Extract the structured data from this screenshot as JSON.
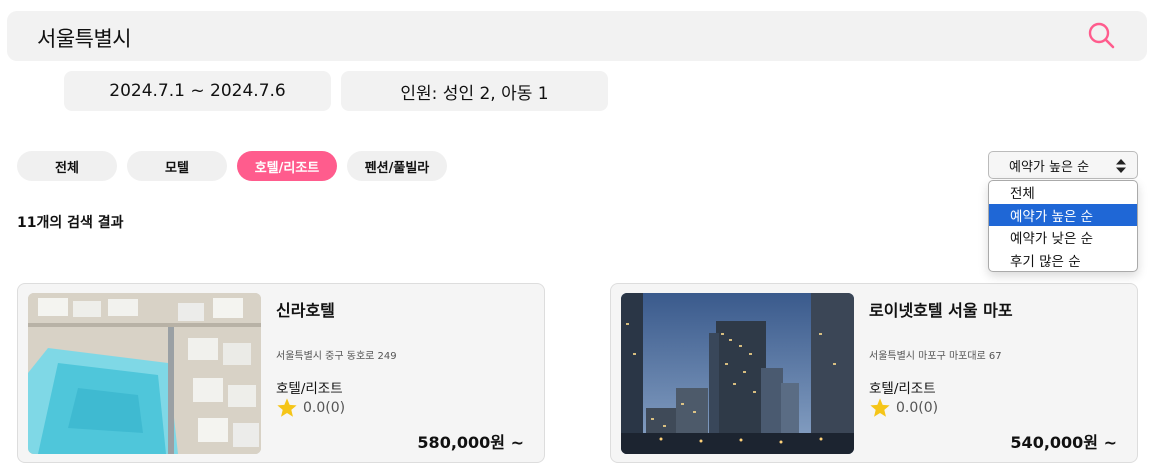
{
  "search": {
    "query": "서울특별시",
    "icon": "search-icon",
    "icon_color": "#ff5c8d"
  },
  "trip": {
    "date_range": "2024.7.1 ~ 2024.7.6",
    "guests": "인원: 성인 2, 아동 1"
  },
  "filters": {
    "tabs": [
      {
        "label": "전체",
        "active": false
      },
      {
        "label": "모텔",
        "active": false
      },
      {
        "label": "호텔/리조트",
        "active": true
      },
      {
        "label": "펜션/풀빌라",
        "active": false
      }
    ],
    "active_color": "#ff5c8d"
  },
  "results": {
    "count_label": "11개의 검색 결과"
  },
  "sort": {
    "selected": "예약가 높은 순",
    "options": [
      "전체",
      "예약가 높은 순",
      "예약가 낮은 순",
      "후기 많은 순"
    ],
    "highlight_color": "#1f67d6"
  },
  "listings": [
    {
      "name": "신라호텔",
      "address": "서울특별시 중구 동호로 249",
      "category": "호텔/리조트",
      "rating": "0.0(0)",
      "price": "580,000원 ~"
    },
    {
      "name": "로이넷호텔 서울 마포",
      "address": "서울특별시 마포구 마포대로 67",
      "category": "호텔/리조트",
      "rating": "0.0(0)",
      "price": "540,000원 ~"
    }
  ],
  "star_color": "#f5c518"
}
